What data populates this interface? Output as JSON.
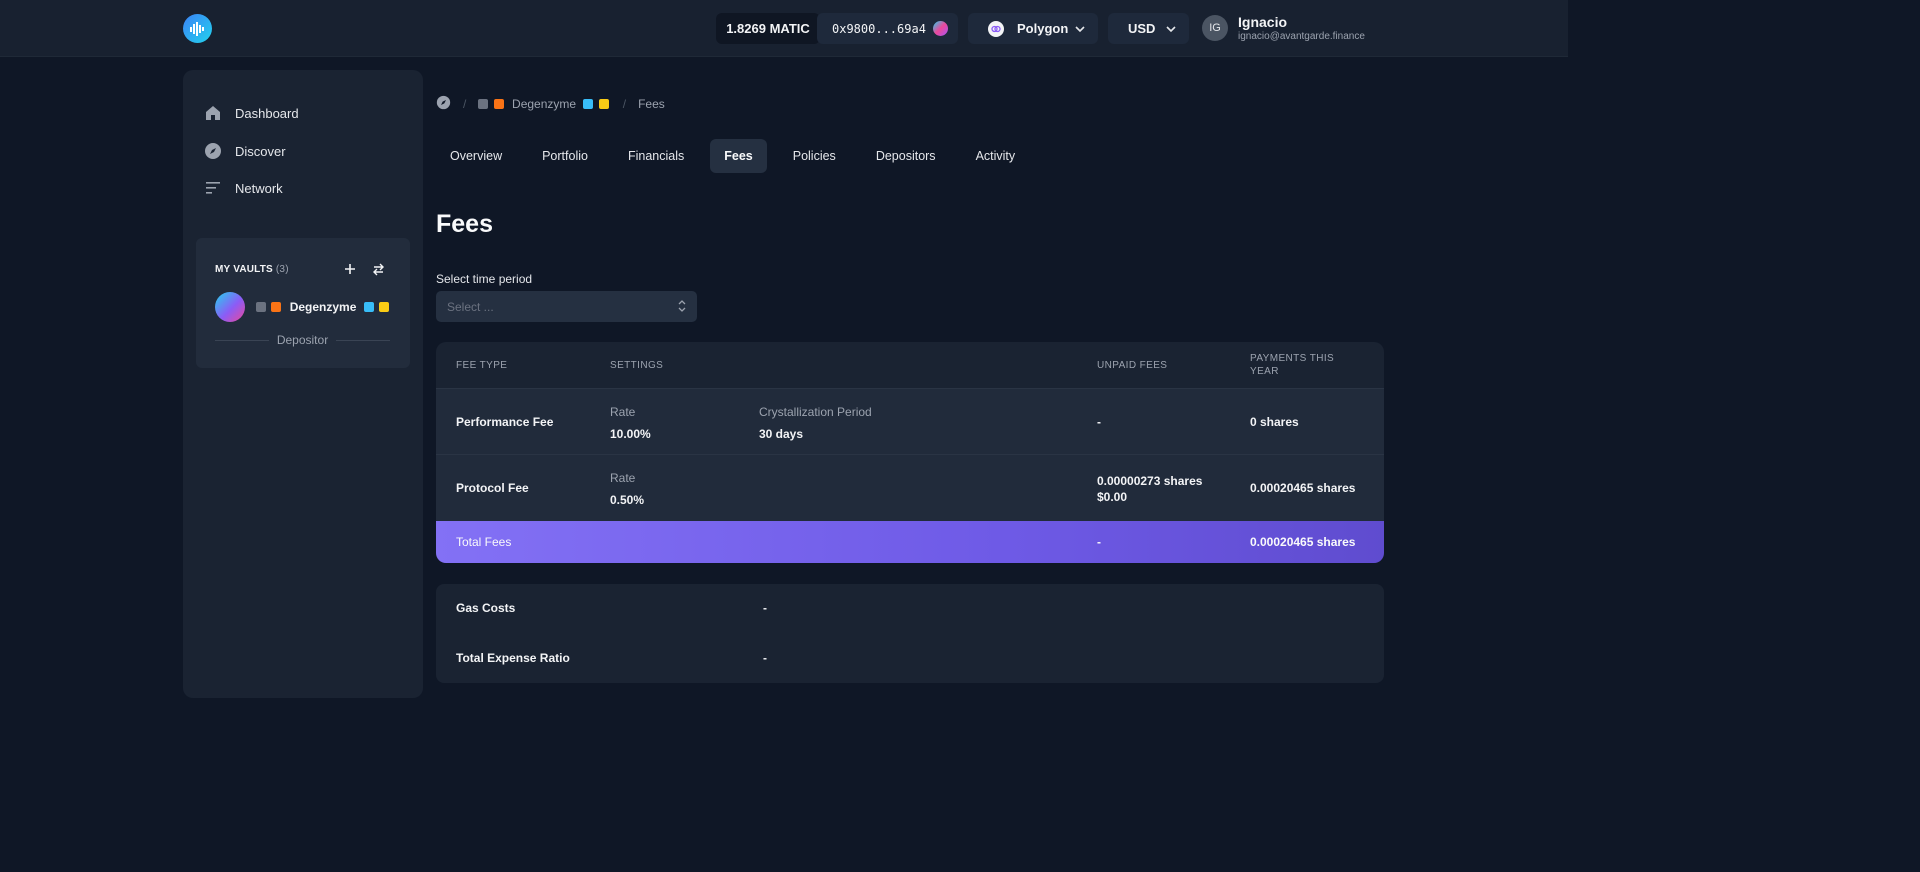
{
  "header": {
    "balance": "1.8269 MATIC",
    "address": "0x9800...69a4",
    "network": "Polygon",
    "currency": "USD",
    "user_initials": "IG",
    "user_name": "Ignacio",
    "user_email": "ignacio@avantgarde.finance"
  },
  "sidebar": {
    "items": [
      {
        "label": "Dashboard",
        "icon": "home-icon"
      },
      {
        "label": "Discover",
        "icon": "compass-icon"
      },
      {
        "label": "Network",
        "icon": "menu-lines-icon"
      }
    ],
    "vaults": {
      "title": "MY VAULTS",
      "count": "(3)",
      "vault_name": "Degenzyme",
      "role": "Depositor"
    }
  },
  "breadcrumb": {
    "vault": "Degenzyme",
    "current": "Fees"
  },
  "tabs": [
    {
      "label": "Overview",
      "active": false
    },
    {
      "label": "Portfolio",
      "active": false
    },
    {
      "label": "Financials",
      "active": false
    },
    {
      "label": "Fees",
      "active": true
    },
    {
      "label": "Policies",
      "active": false
    },
    {
      "label": "Depositors",
      "active": false
    },
    {
      "label": "Activity",
      "active": false
    }
  ],
  "page": {
    "title": "Fees",
    "select_label": "Select time period",
    "select_placeholder": "Select ..."
  },
  "fees_table": {
    "headers": {
      "fee_type": "FEE TYPE",
      "settings": "SETTINGS",
      "unpaid": "UNPAID FEES",
      "payments": "PAYMENTS THIS YEAR"
    },
    "rows": [
      {
        "fee_type": "Performance Fee",
        "setting1_label": "Rate",
        "setting1_value": "10.00%",
        "setting2_label": "Crystallization Period",
        "setting2_value": "30 days",
        "unpaid_line1": "-",
        "unpaid_line2": "",
        "payments": "0 shares"
      },
      {
        "fee_type": "Protocol Fee",
        "setting1_label": "Rate",
        "setting1_value": "0.50%",
        "setting2_label": "",
        "setting2_value": "",
        "unpaid_line1": "0.00000273 shares",
        "unpaid_line2": "$0.00",
        "payments": "0.00020465 shares"
      }
    ],
    "total": {
      "label": "Total Fees",
      "unpaid": "-",
      "payments": "0.00020465 shares"
    }
  },
  "costs": [
    {
      "label": "Gas Costs",
      "value": "-"
    },
    {
      "label": "Total Expense Ratio",
      "value": "-"
    }
  ],
  "colors": {
    "background": "#0f1726",
    "panel": "#1a2332",
    "accent_start": "#8371f5",
    "accent_end": "#5f4ccf"
  }
}
